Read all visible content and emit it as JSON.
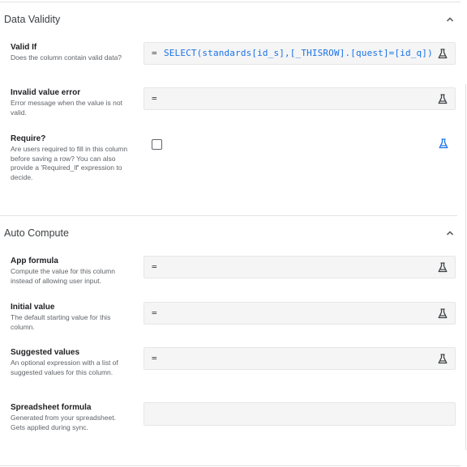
{
  "sections": {
    "data_validity": {
      "title": "Data Validity",
      "icon": "chevron-up-icon"
    },
    "auto_compute": {
      "title": "Auto Compute",
      "icon": "chevron-up-icon"
    }
  },
  "fields": {
    "valid_if": {
      "label": "Valid If",
      "description": "Does the column contain valid data?",
      "prefix": "=",
      "value": "SELECT(standards[id_s],[_THISROW].[quest]=[id_q])",
      "icon": "flask-icon"
    },
    "invalid_value_error": {
      "label": "Invalid value error",
      "description": "Error message when the value is not valid.",
      "prefix": "=",
      "value": "",
      "icon": "flask-icon"
    },
    "require": {
      "label": "Require?",
      "description": "Are users required to fill in this column before saving a row? You can also provide a 'Required_If' expression to decide.",
      "checked": false,
      "icon": "flask-icon"
    },
    "app_formula": {
      "label": "App formula",
      "description": "Compute the value for this column instead of allowing user input.",
      "prefix": "=",
      "value": "",
      "icon": "flask-icon"
    },
    "initial_value": {
      "label": "Initial value",
      "description": "The default starting value for this column.",
      "prefix": "=",
      "value": "",
      "icon": "flask-icon"
    },
    "suggested_values": {
      "label": "Suggested values",
      "description": "An optional expression with a list of suggested values for this column.",
      "prefix": "=",
      "value": "",
      "icon": "flask-icon"
    },
    "spreadsheet_formula": {
      "label": "Spreadsheet formula",
      "description": "Generated from your spreadsheet. Gets applied during sync.",
      "value": ""
    }
  },
  "colors": {
    "accent": "#1a73e8",
    "box_bg": "#f5f5f5",
    "divider": "#e3e3e3"
  }
}
